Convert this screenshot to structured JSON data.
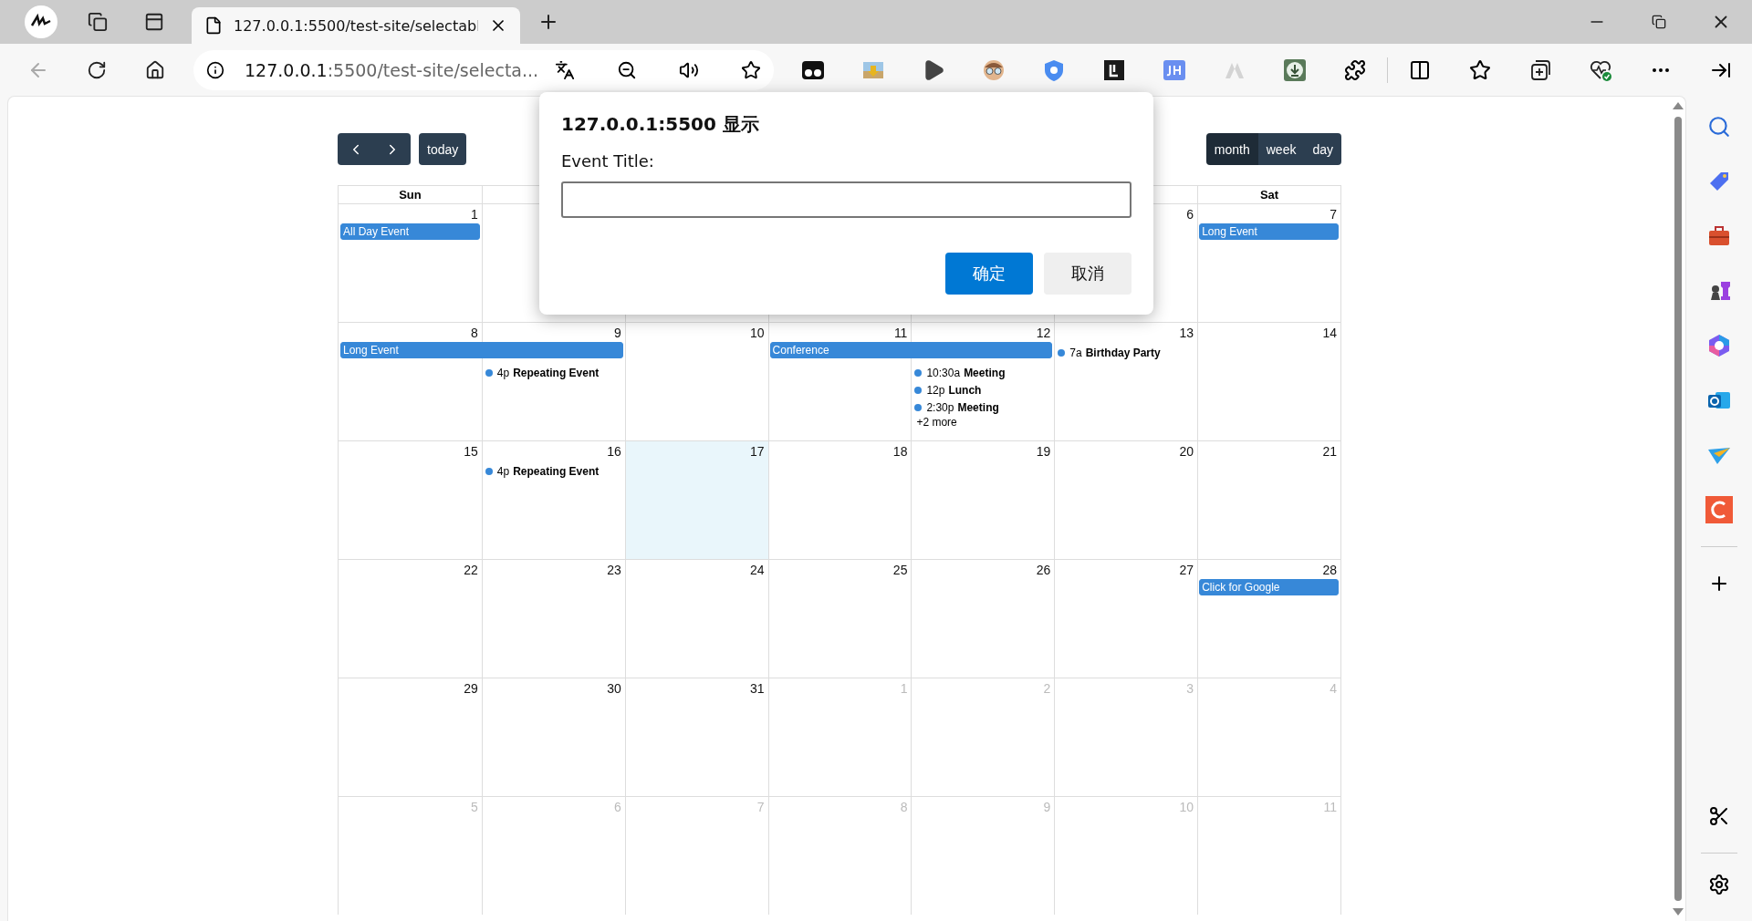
{
  "browser": {
    "tab": {
      "title": "127.0.0.1:5500/test-site/selectabl"
    },
    "address": {
      "host": "127.0.0.1",
      "rest": ":5500/test-site/selecta..."
    }
  },
  "calendar": {
    "toolbar": {
      "today": "today",
      "views": [
        {
          "label": "month",
          "selected": true
        },
        {
          "label": "week",
          "selected": false
        },
        {
          "label": "day",
          "selected": false
        }
      ]
    },
    "headers": {
      "column_1": "Sun",
      "column_7": "Sat"
    },
    "weeks": [
      {
        "days": {
          "column_1": {
            "date": "1",
            "other_month": false,
            "bars": [
              {
                "title": "All Day Event",
                "kind": "single"
              }
            ]
          },
          "column_6": {
            "date": "6",
            "other_month": false
          },
          "column_7": {
            "date": "7",
            "other_month": false,
            "bars": [
              {
                "title": "Long Event",
                "kind": "single"
              }
            ]
          }
        }
      },
      {
        "days": {
          "column_1": {
            "date": "8",
            "other_month": false,
            "bars": [
              {
                "title": "Long Event",
                "kind": "double"
              }
            ]
          },
          "column_2": {
            "date": "9",
            "other_month": false,
            "events": [
              {
                "time": "4p",
                "title": "Repeating Event"
              }
            ]
          },
          "column_3": {
            "date": "10",
            "other_month": false
          },
          "column_4": {
            "date": "11",
            "other_month": false,
            "bars": [
              {
                "title": "Conference",
                "kind": "double"
              }
            ]
          },
          "column_5": {
            "date": "12",
            "other_month": false,
            "events": [
              {
                "time": "10:30a",
                "title": "Meeting"
              },
              {
                "time": "12p",
                "title": "Lunch"
              },
              {
                "time": "2:30p",
                "title": "Meeting"
              }
            ],
            "more": "+2 more"
          },
          "column_6": {
            "date": "13",
            "other_month": false,
            "events": [
              {
                "time": "7a",
                "title": "Birthday Party"
              }
            ]
          },
          "column_7": {
            "date": "14",
            "other_month": false
          }
        }
      },
      {
        "days": {
          "column_1": {
            "date": "15",
            "other_month": false
          },
          "column_2": {
            "date": "16",
            "other_month": false,
            "events": [
              {
                "time": "4p",
                "title": "Repeating Event"
              }
            ]
          },
          "column_3": {
            "date": "17",
            "other_month": false,
            "today": true
          },
          "column_4": {
            "date": "18",
            "other_month": false
          },
          "column_5": {
            "date": "19",
            "other_month": false
          },
          "column_6": {
            "date": "20",
            "other_month": false
          },
          "column_7": {
            "date": "21",
            "other_month": false
          }
        }
      },
      {
        "days": {
          "column_1": {
            "date": "22",
            "other_month": false
          },
          "column_2": {
            "date": "23",
            "other_month": false
          },
          "column_3": {
            "date": "24",
            "other_month": false
          },
          "column_4": {
            "date": "25",
            "other_month": false
          },
          "column_5": {
            "date": "26",
            "other_month": false
          },
          "column_6": {
            "date": "27",
            "other_month": false
          },
          "column_7": {
            "date": "28",
            "other_month": false,
            "bars": [
              {
                "title": "Click for Google",
                "kind": "single"
              }
            ]
          }
        }
      },
      {
        "days": {
          "column_1": {
            "date": "29",
            "other_month": false
          },
          "column_2": {
            "date": "30",
            "other_month": false
          },
          "column_3": {
            "date": "31",
            "other_month": false
          },
          "column_4": {
            "date": "1",
            "other_month": true
          },
          "column_5": {
            "date": "2",
            "other_month": true
          },
          "column_6": {
            "date": "3",
            "other_month": true
          },
          "column_7": {
            "date": "4",
            "other_month": true
          }
        }
      },
      {
        "days": {
          "column_1": {
            "date": "5",
            "other_month": true
          },
          "column_2": {
            "date": "6",
            "other_month": true
          },
          "column_3": {
            "date": "7",
            "other_month": true
          },
          "column_4": {
            "date": "8",
            "other_month": true
          },
          "column_5": {
            "date": "9",
            "other_month": true
          },
          "column_6": {
            "date": "10",
            "other_month": true
          },
          "column_7": {
            "date": "11",
            "other_month": true
          }
        }
      }
    ]
  },
  "dialog": {
    "title": "127.0.0.1:5500 显示",
    "label": "Event Title:",
    "buttons": [
      {
        "label": "确定",
        "kind": "primary"
      },
      {
        "label": "取消",
        "kind": "secondary"
      }
    ]
  }
}
